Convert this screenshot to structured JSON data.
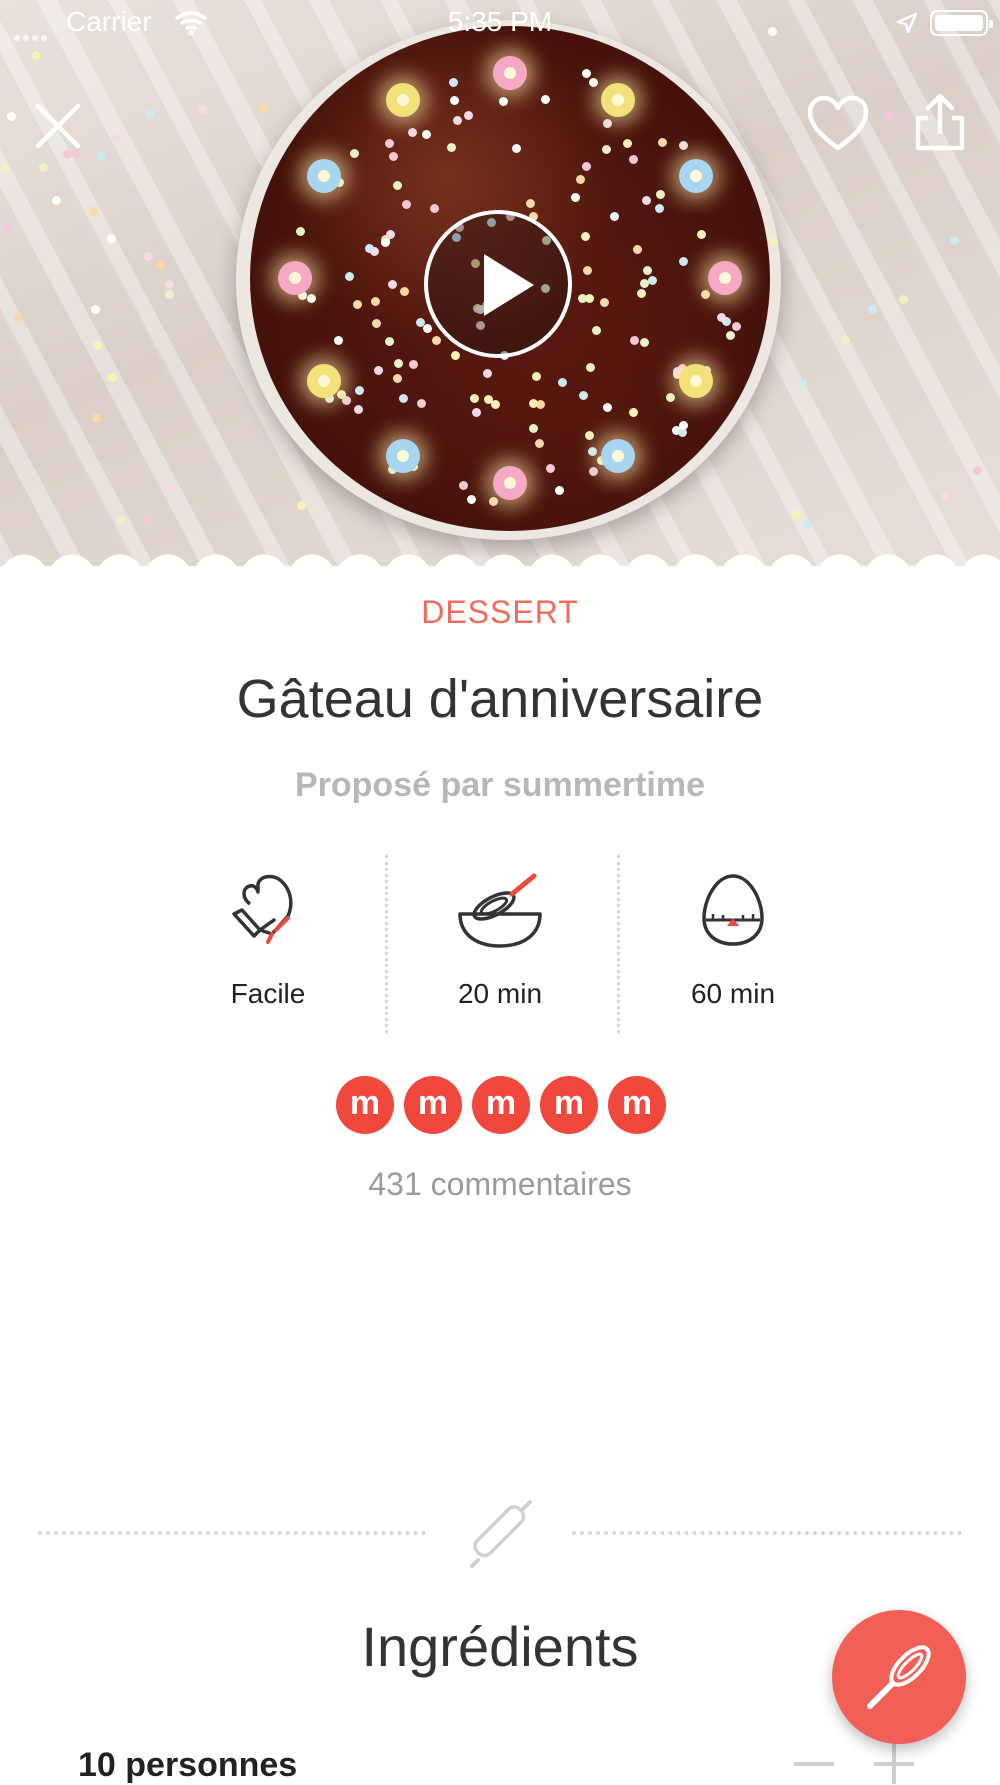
{
  "status_bar": {
    "carrier": "Carrier",
    "time": "5:35 PM"
  },
  "hero": {
    "image_subject": "chocolate-birthday-cake-icon",
    "play_icon": "play-icon"
  },
  "header_actions": {
    "close_icon": "close-icon",
    "favorite_icon": "heart-icon",
    "share_icon": "share-icon"
  },
  "recipe": {
    "category": "DESSERT",
    "title": "Gâteau d'anniversaire",
    "author": "Proposé par summertime",
    "difficulty": "Facile",
    "prep_time": "20 min",
    "cook_time": "60 min",
    "rating_icon_letter": "m",
    "rating_value": 5,
    "rating_max": 5,
    "comments": "431 commentaires"
  },
  "ingredients": {
    "title": "Ingrédients",
    "servings": "10 personnes"
  },
  "colors": {
    "accent": "#f26b5b",
    "rating": "#f0483d",
    "fab": "#f15f56"
  }
}
